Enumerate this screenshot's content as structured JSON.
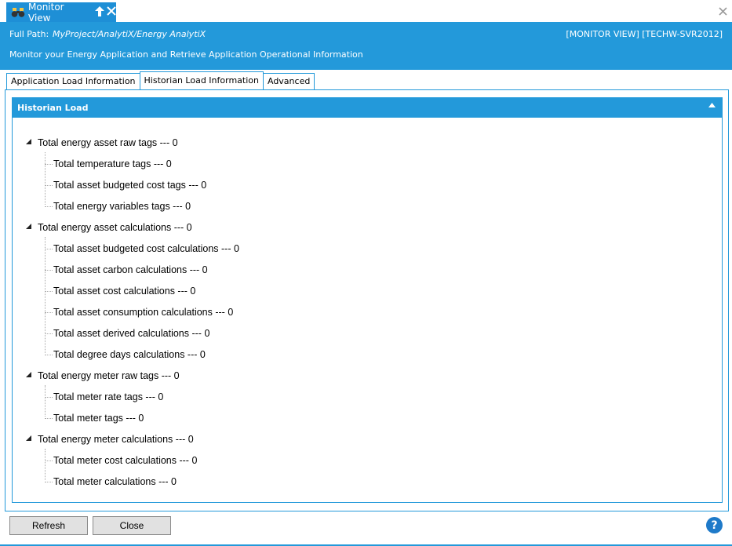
{
  "window": {
    "tab_title": "Monitor View",
    "pin_icon": "pin-up-icon",
    "close_icon": "close-icon"
  },
  "header": {
    "full_path_label": "Full Path:",
    "full_path_value": "MyProject/AnalytiX/Energy AnalytiX",
    "monitor_tag": "[MONITOR VIEW] [TECHW-SVR2012]",
    "description": "Monitor your Energy Application and Retrieve Application Operational Information"
  },
  "tabs": [
    {
      "label": "Application Load Information",
      "active": false
    },
    {
      "label": "Historian Load Information",
      "active": true
    },
    {
      "label": "Advanced",
      "active": false
    }
  ],
  "panel": {
    "title": "Historian Load",
    "collapse_icon": "triangle-up-icon"
  },
  "tree": {
    "g1": {
      "label": "Total energy asset raw tags --- 0",
      "items": [
        "Total temperature tags --- 0",
        "Total asset budgeted cost tags --- 0",
        "Total energy variables tags --- 0"
      ]
    },
    "g2": {
      "label": "Total energy asset calculations --- 0",
      "items": [
        "Total asset budgeted cost calculations --- 0",
        "Total asset carbon calculations --- 0",
        "Total asset cost calculations --- 0",
        "Total asset consumption calculations --- 0",
        "Total asset derived calculations --- 0",
        "Total degree days calculations --- 0"
      ]
    },
    "g3": {
      "label": "Total energy meter raw tags --- 0",
      "items": [
        "Total meter rate  tags --- 0",
        "Total meter tags --- 0"
      ]
    },
    "g4": {
      "label": "Total energy meter calculations --- 0",
      "items": [
        "Total meter cost calculations --- 0",
        "Total meter calculations --- 0"
      ]
    }
  },
  "footer": {
    "refresh_label": "Refresh",
    "close_label": "Close",
    "help_label": "?"
  },
  "colors": {
    "accent": "#2399da",
    "tab_accent": "#1e8fd6"
  }
}
